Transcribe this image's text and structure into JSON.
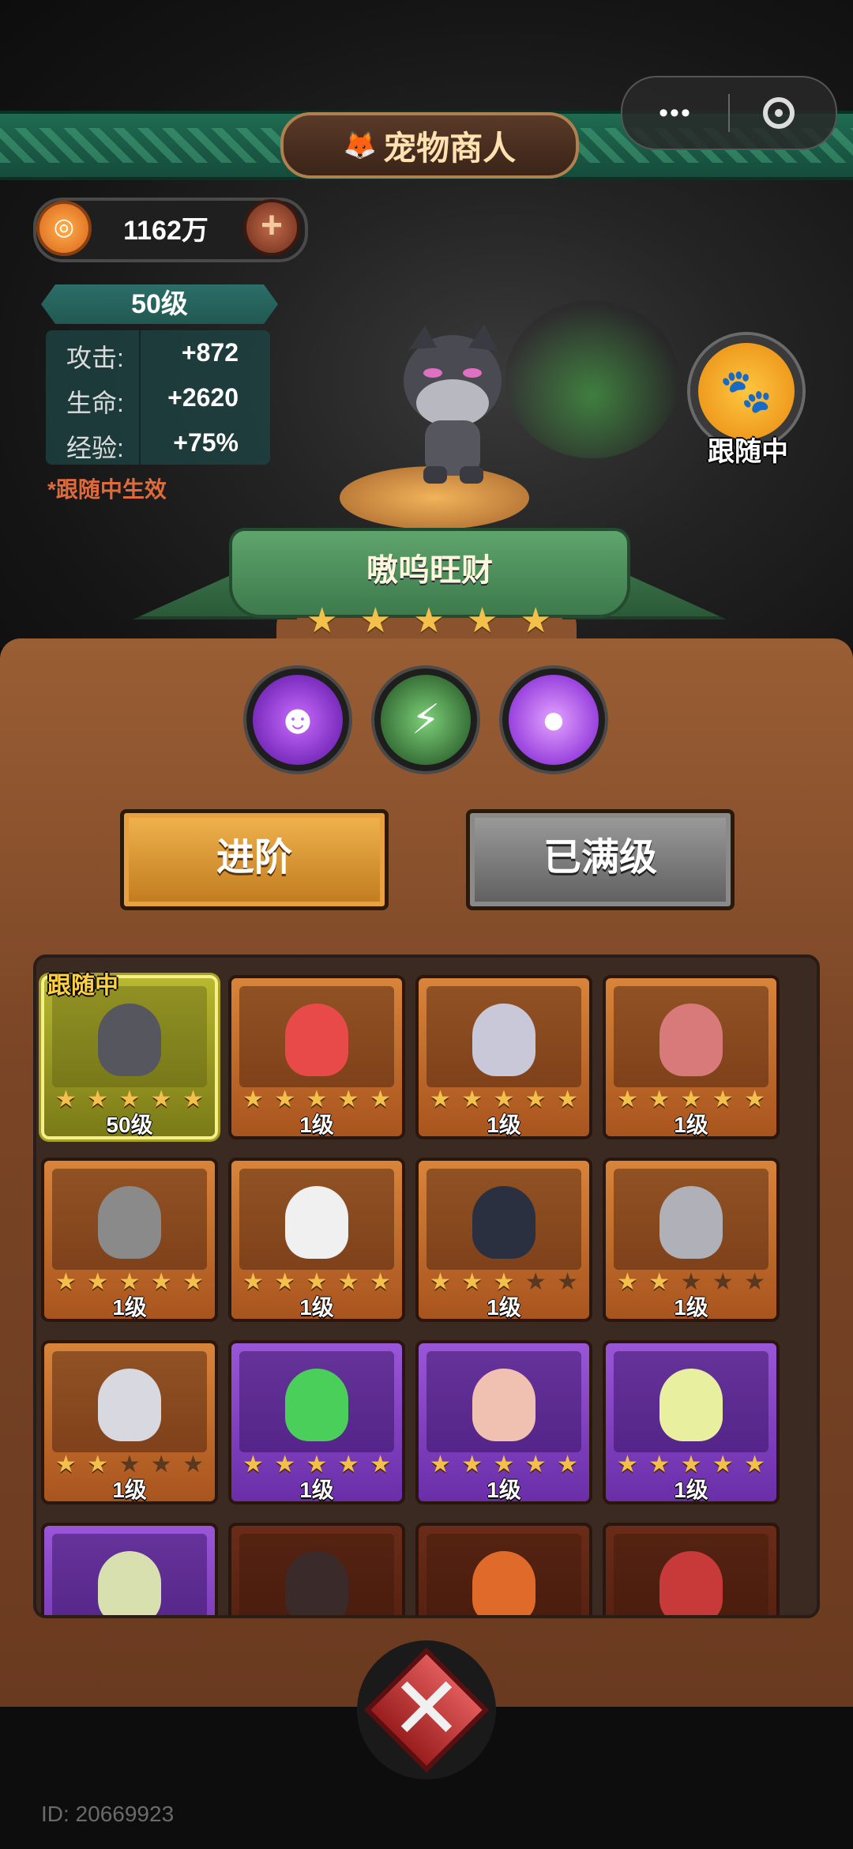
{
  "header": {
    "title": "宠物商人",
    "capsule_dots": "•••"
  },
  "currency": {
    "amount": "1162万",
    "plus": "+"
  },
  "pet_stats": {
    "level": "50级",
    "rows": [
      {
        "label": "攻击:",
        "value": "+872"
      },
      {
        "label": "生命:",
        "value": "+2620"
      },
      {
        "label": "经验:",
        "value": "+75%"
      }
    ],
    "note": "*跟随中生效"
  },
  "pet": {
    "name": "嗷呜旺财",
    "stars": 5,
    "follow_label": "跟随中"
  },
  "skills": [
    "skill-shadow-icon",
    "skill-claw-icon",
    "skill-orb-icon"
  ],
  "buttons": {
    "advance": "进阶",
    "maxed": "已满级"
  },
  "grid": {
    "follow_tag": "跟随中",
    "cards": [
      {
        "level": "50级",
        "stars": 5,
        "rarity": "selected",
        "icon": "black-dog-pet-icon"
      },
      {
        "level": "1级",
        "stars": 5,
        "rarity": "orange",
        "icon": "clown-pet-icon"
      },
      {
        "level": "1级",
        "stars": 5,
        "rarity": "orange",
        "icon": "spider-pet-icon"
      },
      {
        "level": "1级",
        "stars": 5,
        "rarity": "orange",
        "icon": "pig-pet-icon"
      },
      {
        "level": "1级",
        "stars": 5,
        "rarity": "orange",
        "icon": "monkey-pet-icon"
      },
      {
        "level": "1级",
        "stars": 5,
        "rarity": "orange",
        "icon": "duck-pet-icon"
      },
      {
        "level": "1级",
        "stars": 3,
        "rarity": "orange",
        "icon": "crow-pet-icon"
      },
      {
        "level": "1级",
        "stars": 2,
        "rarity": "orange",
        "icon": "knight-pet-icon"
      },
      {
        "level": "1级",
        "stars": 2,
        "rarity": "orange",
        "icon": "gauntlet-pet-icon"
      },
      {
        "level": "1级",
        "stars": 5,
        "rarity": "purple",
        "icon": "frog-pet-icon"
      },
      {
        "level": "1级",
        "stars": 5,
        "rarity": "purple",
        "icon": "chicken-pet-icon"
      },
      {
        "level": "1级",
        "stars": 5,
        "rarity": "purple",
        "icon": "chick-pet-icon"
      },
      {
        "level": "",
        "stars": 0,
        "rarity": "purple",
        "icon": "owl-pet-icon"
      },
      {
        "level": "",
        "stars": 0,
        "rarity": "dark",
        "icon": "chomper-pet-icon"
      },
      {
        "level": "",
        "stars": 0,
        "rarity": "dark",
        "icon": "dragon-pet-icon"
      },
      {
        "level": "",
        "stars": 0,
        "rarity": "dark",
        "icon": "daruma-pet-icon"
      }
    ]
  },
  "footer": {
    "id_text": "ID: 20669923"
  },
  "colors": {
    "accent_gold": "#f3c04c",
    "banner_green": "#1f6b52",
    "panel_brown": "#7a4526"
  }
}
